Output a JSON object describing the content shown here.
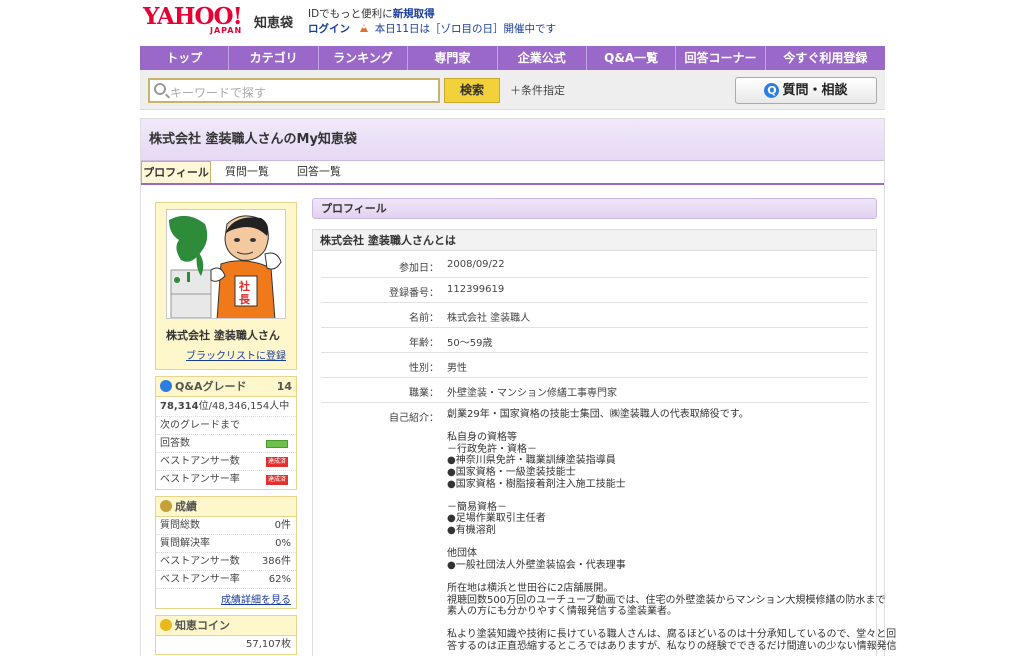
{
  "header": {
    "logo_main": "YAHOO!",
    "logo_sub": "JAPAN",
    "service_name": "知恵袋",
    "line1_text": "IDでもっと便利に",
    "line1_link": "新規取得",
    "login": "ログイン",
    "notice": "本日11日は［ゾロ目の日］開催中です"
  },
  "nav": {
    "items": [
      "トップ",
      "カテゴリ",
      "ランキング",
      "専門家",
      "企業公式",
      "Q&A一覧",
      "回答コーナー",
      "今すぐ利用登録"
    ]
  },
  "search": {
    "placeholder": "キーワードで探す",
    "button": "検索",
    "condition": "＋条件指定",
    "ask_button": "質問・相談",
    "ask_icon": "Q"
  },
  "page": {
    "title": "株式会社 塗装職人さんのMy知恵袋",
    "tabs": [
      "プロフィール",
      "質問一覧",
      "回答一覧"
    ]
  },
  "sidebar": {
    "name": "株式会社 塗装職人さん",
    "blacklist": "ブラックリストに登録",
    "grade": {
      "title": "Q&Aグレード",
      "level": "14",
      "rank_value": "78,314",
      "rank_suffix": "位/48,346,154人中",
      "next_label": "次のグレードまで",
      "answers_label": "回答数",
      "best_count_label": "ベストアンサー数",
      "best_rate_label": "ベストアンサー率",
      "badge": "達成済"
    },
    "results": {
      "title": "成績",
      "rows": [
        {
          "label": "質問総数",
          "value": "0件"
        },
        {
          "label": "質問解決率",
          "value": "0%"
        },
        {
          "label": "ベストアンサー数",
          "value": "386件"
        },
        {
          "label": "ベストアンサー率",
          "value": "62%"
        }
      ],
      "detail_link": "成績詳細を見る"
    },
    "coin": {
      "title": "知恵コイン",
      "value": "57,107枚"
    }
  },
  "profile": {
    "section_title": "プロフィール",
    "box_title": "株式会社 塗装職人さんとは",
    "fields": [
      {
        "key": "参加日：",
        "value": "2008/09/22"
      },
      {
        "key": "登録番号：",
        "value": "112399619"
      },
      {
        "key": "名前：",
        "value": "株式会社 塗装職人"
      },
      {
        "key": "年齢：",
        "value": "50～59歳"
      },
      {
        "key": "性別：",
        "value": "男性"
      },
      {
        "key": "職業：",
        "value": "外壁塗装・マンション修繕工事専門家"
      }
    ],
    "intro_key": "自己紹介：",
    "intro_text": "創業29年・国家資格の技能士集団、㈱塗装職人の代表取締役です。\n\n私自身の資格等\n－行政免許・資格－\n●神奈川県免許・職業訓練塗装指導員\n●国家資格・一級塗装技能士\n●国家資格・樹脂接着剤注入施工技能士\n\n－簡易資格－\n●足場作業取引主任者\n●有機溶剤\n\n他団体\n●一般社団法人外壁塗装協会・代表理事\n\n所在地は横浜と世田谷に2店舗展開。\n視聴回数500万回のユーチューブ動画では、住宅の外壁塗装からマンション大規模修繕の防水まで\n素人の方にも分かりやすく情報発信する塗装業者。\n\n私より塗装知識や技術に長けている職人さんは、腐るほどいるのは十分承知しているので、堂々と回\n答するのは正直恐縮するところではありますが、私なりの経験でできるだけ間違いの少ない情報発信"
  }
}
